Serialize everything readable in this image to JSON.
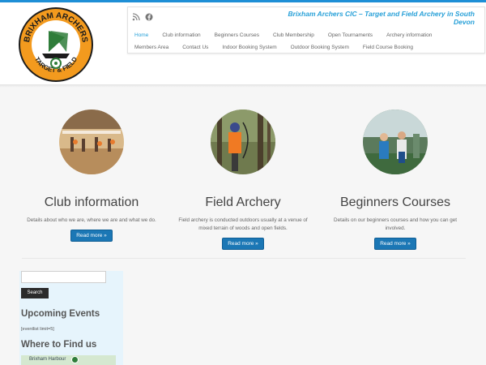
{
  "site": {
    "tagline": "Brixham Archers CIC – Target and Field Archery in South Devon",
    "logo_text_top": "BRIXHAM ARCHERS",
    "logo_text_bottom": "TARGET & FIELD"
  },
  "nav": {
    "row1": [
      "Home",
      "Club information",
      "Beginners Courses",
      "Club Membership",
      "Open Tournaments",
      "Archery information"
    ],
    "row2": [
      "Members Area",
      "Contact Us",
      "Indoor Booking System",
      "Outdoor Booking System",
      "Field Course Booking"
    ],
    "active": "Home"
  },
  "social": [
    "rss-icon",
    "facebook-icon"
  ],
  "features": [
    {
      "title": "Club information",
      "text": "Details about who we are, where we are and what we do.",
      "button": "Read more »"
    },
    {
      "title": "Field Archery",
      "text": "Field archery is conducted outdoors usually at a venue of mixed terrain of woods and open fields.",
      "button": "Read more »"
    },
    {
      "title": "Beginners Courses",
      "text": "Details on our beginners courses and how you can get involved.",
      "button": "Read more »"
    }
  ],
  "sidebar": {
    "search_button": "Search",
    "search_placeholder": "",
    "upcoming_title": "Upcoming Events",
    "shortcode": "[eventlist limit=5]",
    "find_title": "Where to Find us",
    "map_label": "Brixham Harbour"
  },
  "colors": {
    "accent": "#27a0d8",
    "button": "#1b77b5",
    "logo_orange": "#f39a1e",
    "logo_green": "#2f7d3a"
  }
}
